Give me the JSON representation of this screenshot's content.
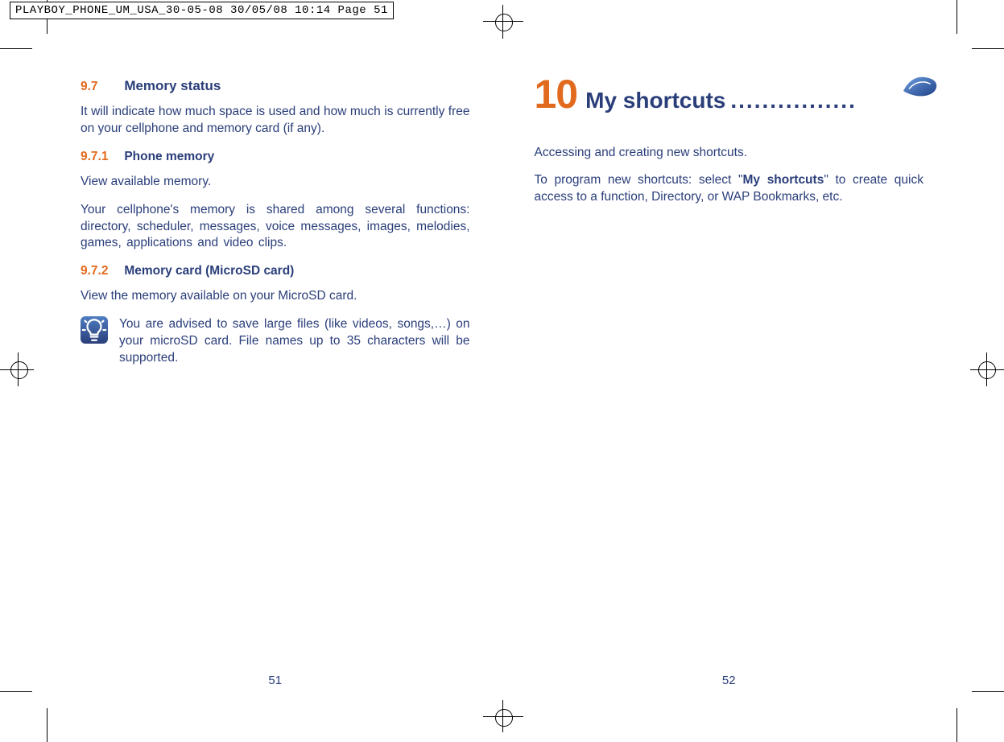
{
  "preflight_header": "PLAYBOY_PHONE_UM_USA_30-05-08  30/05/08  10:14  Page 51",
  "left_page": {
    "sec_num": "9.7",
    "sec_title": "Memory status",
    "intro": "It will indicate how much space is used and how much is currently free on your cellphone and memory card (if any).",
    "sub1_num": "9.7.1",
    "sub1_title": "Phone memory",
    "sub1_p1": "View available memory.",
    "sub1_p2": "Your cellphone's memory is shared among several functions: directory, scheduler, messages, voice messages, images, melodies, games, applications and video clips.",
    "sub2_num": "9.7.2",
    "sub2_title": "Memory card (MicroSD card)",
    "sub2_p1": "View the memory available on your MicroSD card.",
    "tip": "You are advised to save large files (like videos, songs,…) on your microSD card.  File names up to 35 characters will be supported.",
    "page_number": "51"
  },
  "right_page": {
    "chapter_num": "10",
    "chapter_title": "My shortcuts",
    "chapter_dots": "................",
    "p1": "Accessing and creating new shortcuts.",
    "p2_pre": "To program new shortcuts: select \"",
    "p2_bold": "My shortcuts",
    "p2_post": "\" to create quick access to a function,  Directory,  or WAP Bookmarks,  etc.",
    "page_number": "52"
  }
}
